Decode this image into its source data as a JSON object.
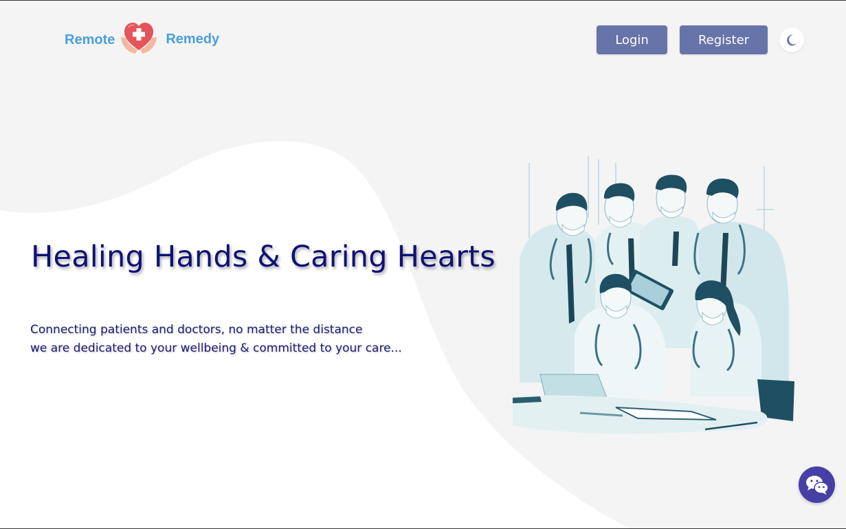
{
  "header": {
    "logo": {
      "left_text": "Remote",
      "right_text": "Remedy",
      "icon": "heart-hands-cross-icon",
      "color": "#4a9fdc"
    },
    "login_label": "Login",
    "register_label": "Register",
    "theme_toggle_icon": "moon-icon",
    "button_color": "#6774a9"
  },
  "hero": {
    "title": "Healing Hands & Caring Hearts",
    "subtitle_line1": "Connecting patients and doctors, no matter the distance",
    "subtitle_line2": "we are dedicated to your wellbeing & committed to your care...",
    "title_color": "#0f1270",
    "illustration": "doctors-team-illustration"
  },
  "chat": {
    "icon": "wechat-chat-icon",
    "color": "#453fa6"
  }
}
